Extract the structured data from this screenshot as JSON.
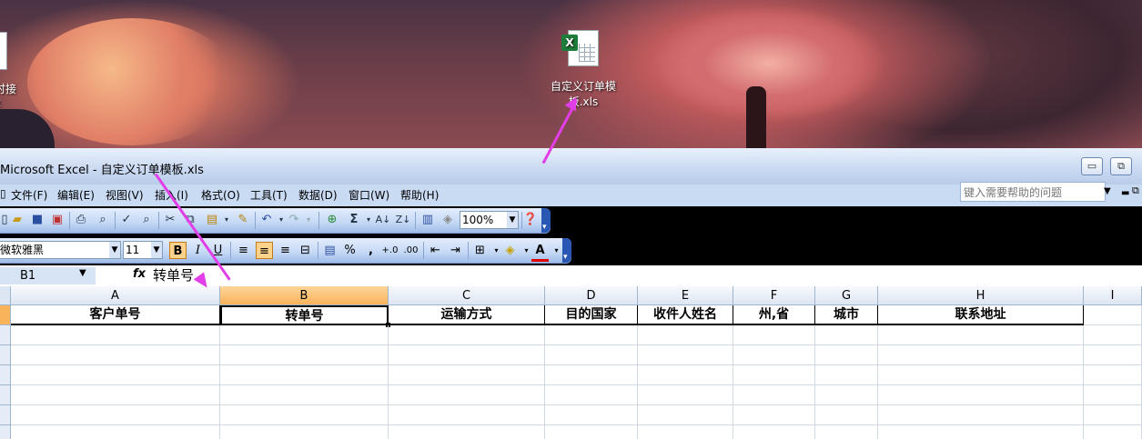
{
  "desktop": {
    "icons": [
      {
        "name": "partial-icon",
        "label": "时接\nx"
      },
      {
        "name": "excel-file-icon",
        "label": "自定义订单模\n板.xls"
      }
    ]
  },
  "window": {
    "title": "Microsoft Excel - 自定义订单模板.xls",
    "buttons": {
      "minimize": "▭",
      "restore": "⧉"
    }
  },
  "menu": {
    "items": [
      "文件(F)",
      "编辑(E)",
      "视图(V)",
      "插入(I)",
      "格式(O)",
      "工具(T)",
      "数据(D)",
      "窗口(W)",
      "帮助(H)"
    ],
    "help_placeholder": "键入需要帮助的问题"
  },
  "toolbar": {
    "zoom": "100%",
    "font": "微软雅黑",
    "font_size": "11",
    "bold": "B",
    "italic": "I",
    "underline": "U",
    "percent": "%",
    "comma": ",",
    "sigma": "Σ"
  },
  "formula_bar": {
    "name_box": "B1",
    "fx": "fx",
    "content": "转单号"
  },
  "sheet": {
    "columns": [
      "A",
      "B",
      "C",
      "D",
      "E",
      "F",
      "G",
      "H",
      "I"
    ],
    "selected_column": "B",
    "header_row": [
      "客户单号",
      "转单号",
      "运输方式",
      "目的国家",
      "收件人姓名",
      "州,省",
      "城市",
      "联系地址",
      ""
    ],
    "active_cell": "B1"
  },
  "colors": {
    "selection": "#f9b35a",
    "arrow": "#e23ee8",
    "toolbar_blue": "#c4d8f5"
  }
}
